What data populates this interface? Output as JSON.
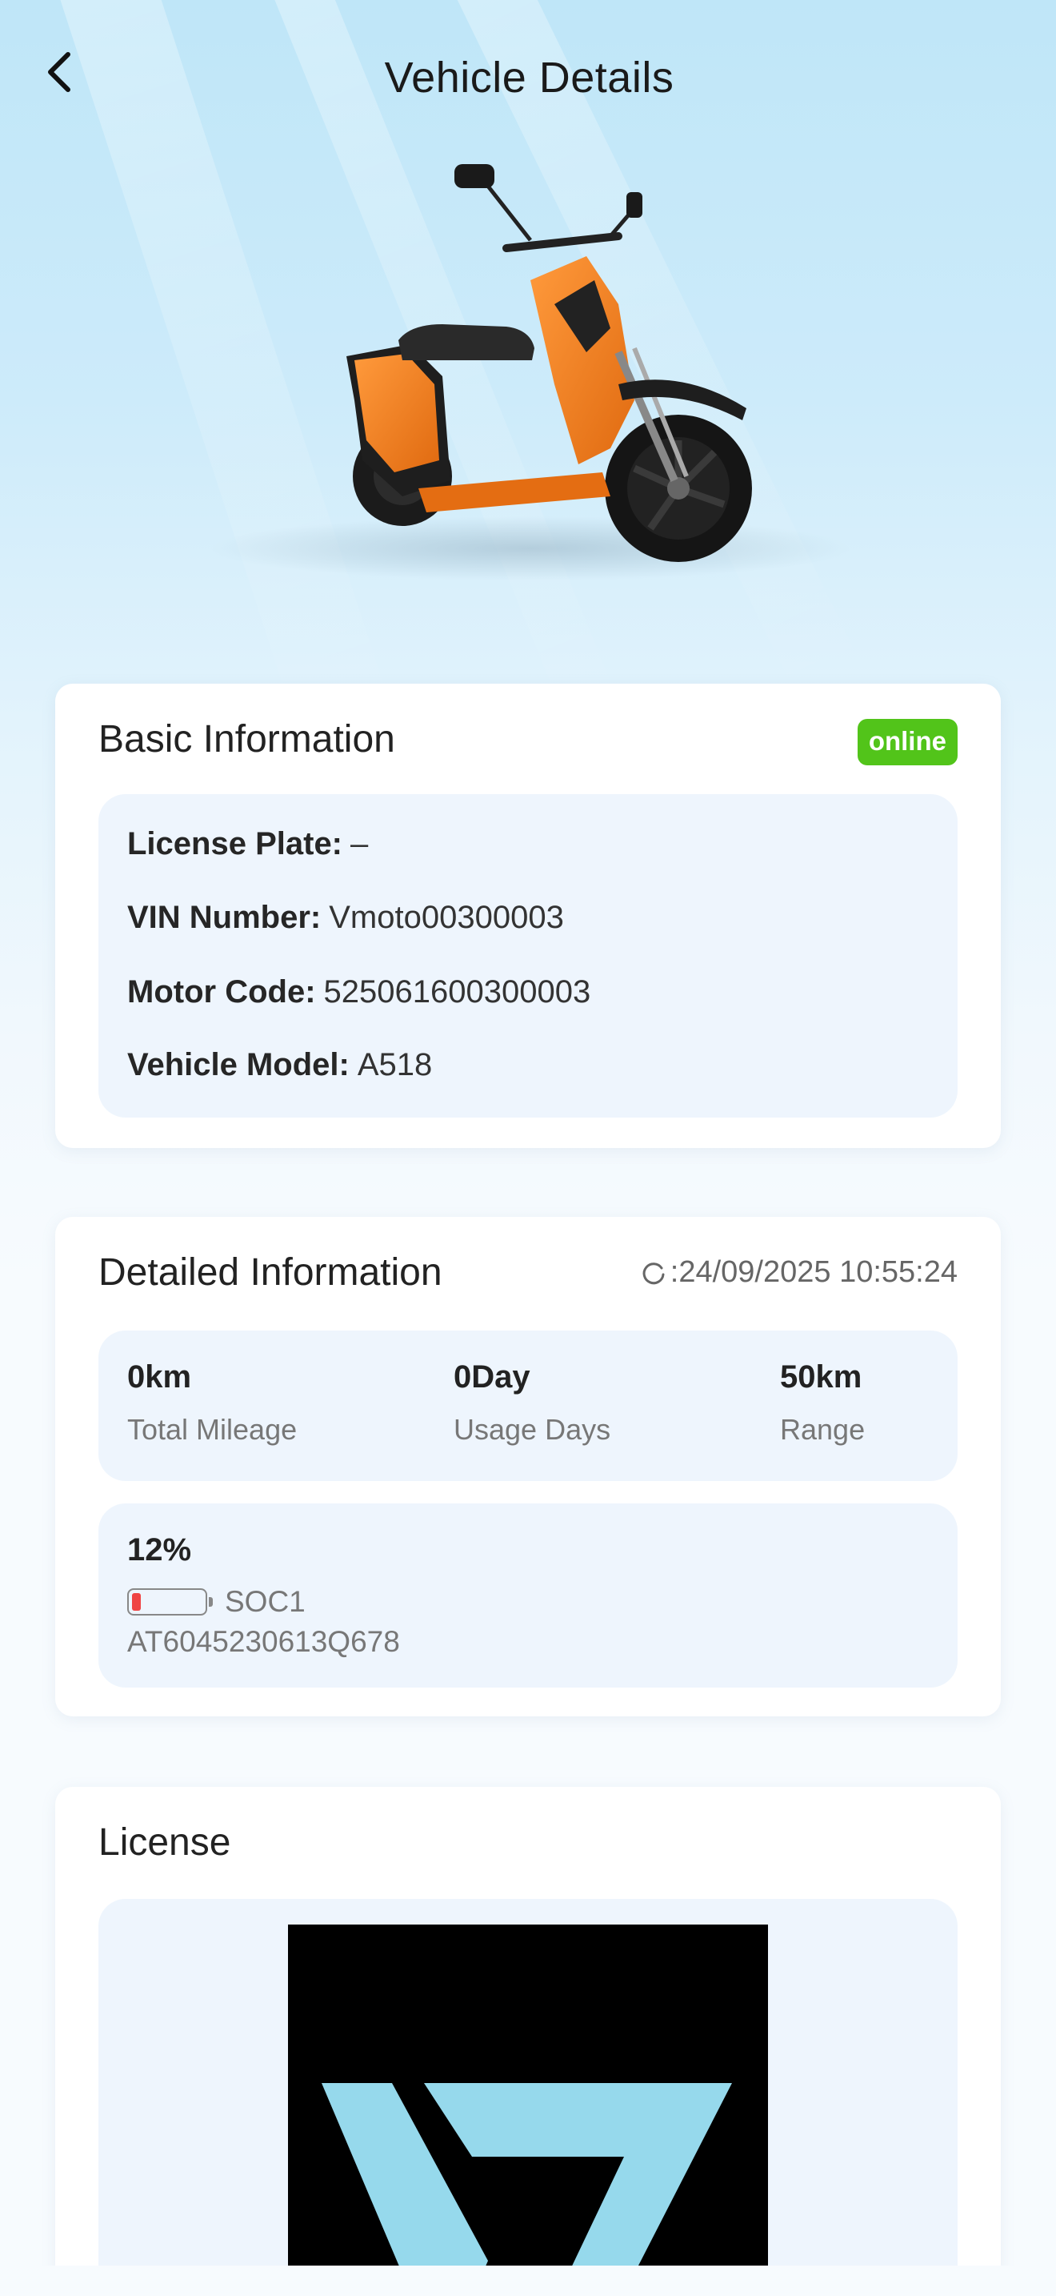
{
  "header": {
    "title": "Vehicle Details",
    "back_icon": "chevron-left-icon"
  },
  "basic_info": {
    "title": "Basic Information",
    "status": "online",
    "status_color": "#52c41a",
    "rows": [
      {
        "label": "License Plate:",
        "value": "–"
      },
      {
        "label": "VIN Number:",
        "value": "Vmoto00300003"
      },
      {
        "label": "Motor Code:",
        "value": "525061600300003"
      },
      {
        "label": "Vehicle Model:",
        "value": "A518"
      }
    ]
  },
  "detailed_info": {
    "title": "Detailed Information",
    "refresh_icon": "refresh-icon",
    "updated_at": ":24/09/2025 10:55:24",
    "stats": [
      {
        "value": "0km",
        "caption": "Total Mileage"
      },
      {
        "value": "0Day",
        "caption": "Usage Days"
      },
      {
        "value": "50km",
        "caption": "Range"
      }
    ],
    "battery": {
      "percent_text": "12%",
      "level": 0.12,
      "label": "SOC1",
      "id": "AT6045230613Q678",
      "fill_color": "#ef4444"
    }
  },
  "license": {
    "title": "License",
    "logo_color": "#96d9ec"
  }
}
